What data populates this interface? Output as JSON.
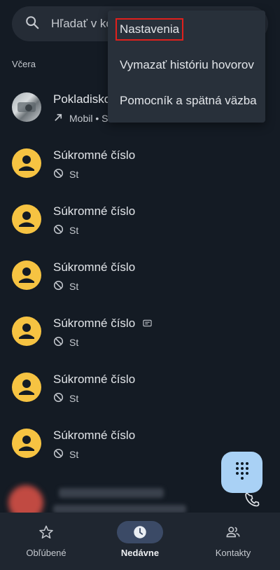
{
  "search": {
    "placeholder": "Hľadať v ko"
  },
  "section": {
    "label": "Včera"
  },
  "calls": [
    {
      "name": "Pokladisko",
      "detail": "Mobil • S",
      "avatar": "photo",
      "call_type": "outgoing-arrow-icon"
    },
    {
      "name": "Súkromné číslo",
      "detail": "St",
      "avatar": "person",
      "call_type": "blocked-icon"
    },
    {
      "name": "Súkromné číslo",
      "detail": "St",
      "avatar": "person",
      "call_type": "blocked-icon"
    },
    {
      "name": "Súkromné číslo",
      "detail": "St",
      "avatar": "person",
      "call_type": "blocked-icon"
    },
    {
      "name": "Súkromné číslo",
      "detail": "St",
      "avatar": "person",
      "call_type": "blocked-icon",
      "badge": "rtt-icon"
    },
    {
      "name": "Súkromné číslo",
      "detail": "St",
      "avatar": "person",
      "call_type": "blocked-icon"
    },
    {
      "name": "Súkromné číslo",
      "detail": "St",
      "avatar": "person",
      "call_type": "blocked-icon"
    }
  ],
  "menu": {
    "items": [
      {
        "label": "Nastavenia",
        "highlighted": true
      },
      {
        "label": "Vymazať históriu hovorov"
      },
      {
        "label": "Pomocník a spätná väzba"
      }
    ]
  },
  "nav": {
    "items": [
      {
        "label": "Obľúbené",
        "icon": "star-icon",
        "active": false
      },
      {
        "label": "Nedávne",
        "icon": "clock-icon",
        "active": true
      },
      {
        "label": "Kontakty",
        "icon": "people-icon",
        "active": false
      }
    ]
  },
  "colors": {
    "background": "#141b24",
    "avatar_yellow": "#f6c342",
    "fab": "#a9d1f5",
    "nav_active": "#3b4a66",
    "highlight_outline": "#e0201c"
  }
}
